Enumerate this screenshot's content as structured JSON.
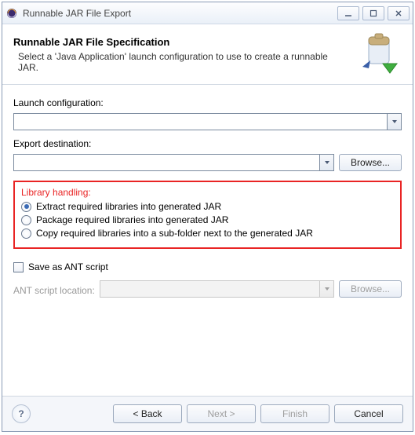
{
  "window": {
    "title": "Runnable JAR File Export"
  },
  "banner": {
    "title": "Runnable JAR File Specification",
    "description": "Select a 'Java Application' launch configuration to use to create a runnable JAR."
  },
  "launch": {
    "label": "Launch configuration:",
    "value": ""
  },
  "export": {
    "label": "Export destination:",
    "value": "",
    "browse": "Browse..."
  },
  "library": {
    "legend": "Library handling:",
    "options": [
      "Extract required libraries into generated JAR",
      "Package required libraries into generated JAR",
      "Copy required libraries into a sub-folder next to the generated JAR"
    ],
    "selected": 0
  },
  "ant": {
    "save_label": "Save as ANT script",
    "location_label": "ANT script location:",
    "value": "",
    "browse": "Browse..."
  },
  "footer": {
    "back": "< Back",
    "next": "Next >",
    "finish": "Finish",
    "cancel": "Cancel"
  }
}
